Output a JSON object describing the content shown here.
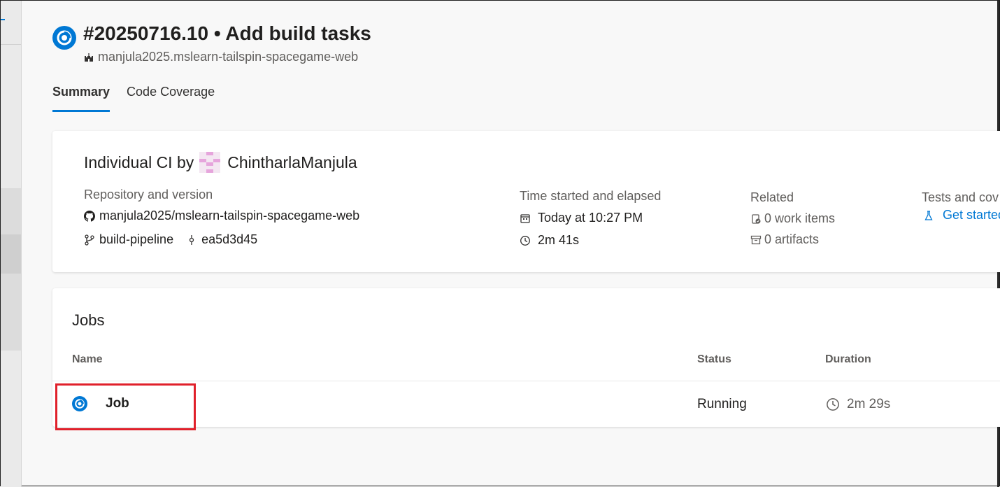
{
  "build": {
    "title": "#20250716.10 • Add build tasks",
    "project": "manjula2025.mslearn-tailspin-spacegame-web"
  },
  "tabs": [
    {
      "label": "Summary",
      "active": true
    },
    {
      "label": "Code Coverage",
      "active": false
    }
  ],
  "summary": {
    "trigger_prefix": "Individual CI by",
    "user": "ChintharlaManjula",
    "repository": {
      "label": "Repository and version",
      "repo": "manjula2025/mslearn-tailspin-spacegame-web",
      "branch": "build-pipeline",
      "commit": "ea5d3d45"
    },
    "time": {
      "label": "Time started and elapsed",
      "started": "Today at 10:27 PM",
      "elapsed": "2m 41s"
    },
    "related": {
      "label": "Related",
      "work_items": "0 work items",
      "artifacts": "0 artifacts"
    },
    "tests": {
      "label": "Tests and cov",
      "link": "Get started"
    }
  },
  "jobs": {
    "title": "Jobs",
    "columns": {
      "name": "Name",
      "status": "Status",
      "duration": "Duration"
    },
    "rows": [
      {
        "name": "Job",
        "status": "Running",
        "duration": "2m 29s"
      }
    ]
  },
  "colors": {
    "accent": "#0078d4",
    "highlight": "#e0202a"
  }
}
